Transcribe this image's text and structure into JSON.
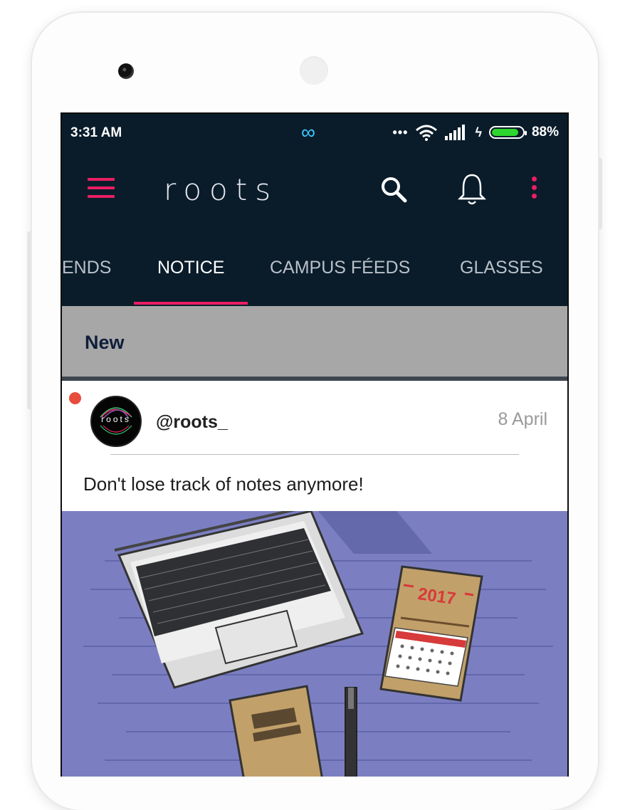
{
  "status_bar": {
    "time": "3:31 AM",
    "sync_icon": "infinity-icon",
    "dots": "•••",
    "battery_percent": "88%",
    "battery_level": 0.88
  },
  "app_bar": {
    "title": "roots"
  },
  "tabs": [
    {
      "label": "ENDS"
    },
    {
      "label": "NOTICE"
    },
    {
      "label": "CAMPUS FÉEDS"
    },
    {
      "label": "GLASSES"
    }
  ],
  "section": {
    "title": "New"
  },
  "post": {
    "avatar_text": "roots",
    "username": "@roots_",
    "date": "8 April",
    "text": "Don't lose track of notes anymore!",
    "image_year": "2017"
  },
  "colors": {
    "appbar_bg": "#0a1c2a",
    "accent": "#e91e63",
    "section_bg": "#a7a7a7",
    "image_bg": "#7b7fc2"
  }
}
